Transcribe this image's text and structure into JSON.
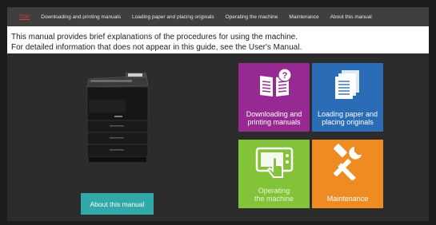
{
  "nav": {
    "items": [
      {
        "label": "TOP"
      },
      {
        "label": "Downloading and printing manuals"
      },
      {
        "label": "Loading paper and placing originals"
      },
      {
        "label": "Operating the machine"
      },
      {
        "label": "Maintenance"
      },
      {
        "label": "About this manual"
      }
    ]
  },
  "intro": {
    "line1": "This manual provides brief explanations of the procedures for using the machine.",
    "line2": "For detailed information that does not appear in this guide, see the User's Manual."
  },
  "about_button": {
    "label": "About this manual"
  },
  "tiles": [
    {
      "label": "Downloading and\nprinting manuals",
      "icon": "book-question-icon",
      "color": "#972a92"
    },
    {
      "label": "Loading paper and\nplacing originals",
      "icon": "paper-stack-icon",
      "color": "#2a6db6"
    },
    {
      "label": "Operating\nthe machine",
      "icon": "touch-panel-icon",
      "color": "#82c33a"
    },
    {
      "label": "Maintenance",
      "icon": "wrench-hammer-icon",
      "color": "#ee8b22"
    }
  ],
  "colors": {
    "nav_bg": "#3f3f3f",
    "nav_active": "#d93c3c",
    "content_bg": "#2c2c2c",
    "about_button": "#30a9a8"
  }
}
